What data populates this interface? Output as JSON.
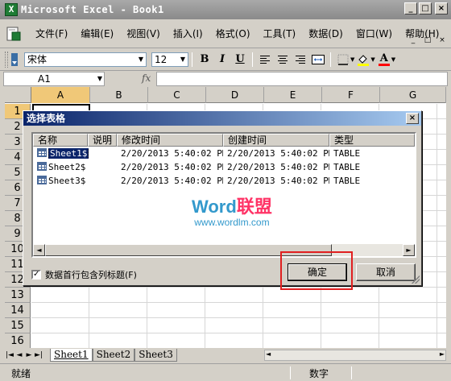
{
  "window": {
    "title": "Microsoft Excel - Book1",
    "app_icon": "X",
    "buttons": [
      "_",
      "□",
      "×"
    ]
  },
  "menu": {
    "items": [
      "文件(F)",
      "编辑(E)",
      "视图(V)",
      "插入(I)",
      "格式(O)",
      "工具(T)",
      "数据(D)",
      "窗口(W)",
      "帮助(H)"
    ],
    "right_buttons": [
      "_",
      "□",
      "×"
    ]
  },
  "toolbar": {
    "font_name": "宋体",
    "font_size": "12",
    "bold": "B",
    "italic": "I",
    "underline": "U",
    "font_color": "A"
  },
  "formula_bar": {
    "name_box": "A1",
    "fx_label": "fx",
    "formula": ""
  },
  "grid": {
    "columns": [
      "A",
      "B",
      "C",
      "D",
      "E",
      "F",
      "G"
    ],
    "rows": [
      "1",
      "2",
      "3",
      "4",
      "5",
      "6",
      "7",
      "8",
      "9",
      "10",
      "11",
      "12",
      "13",
      "14",
      "15",
      "16"
    ],
    "active_cell": "A1"
  },
  "sheet_tabs": {
    "nav": [
      "|◄",
      "◄",
      "►",
      "►|"
    ],
    "tabs": [
      "Sheet1",
      "Sheet2",
      "Sheet3"
    ],
    "active": "Sheet1"
  },
  "status_bar": {
    "left": "就绪",
    "right": "数字"
  },
  "dialog": {
    "title": "选择表格",
    "close": "×",
    "columns": [
      "名称",
      "说明",
      "修改时间",
      "创建时间",
      "类型"
    ],
    "rows": [
      {
        "name": "Sheet1$",
        "description": "",
        "modified": "2/20/2013 5:40:02 PM",
        "created": "2/20/2013 5:40:02 PM",
        "type": "TABLE"
      },
      {
        "name": "Sheet2$",
        "description": "",
        "modified": "2/20/2013 5:40:02 PM",
        "created": "2/20/2013 5:40:02 PM",
        "type": "TABLE"
      },
      {
        "name": "Sheet3$",
        "description": "",
        "modified": "2/20/2013 5:40:02 PM",
        "created": "2/20/2013 5:40:02 PM",
        "type": "TABLE"
      }
    ],
    "selected_row": 0,
    "checkbox_label": "数据首行包含列标题(F)",
    "checkbox_checked": "✓",
    "ok_label": "确定",
    "cancel_label": "取消",
    "scroll_left": "◄",
    "scroll_right": "►"
  },
  "watermark": {
    "brand_prefix": "Word",
    "brand_suffix": "联盟",
    "url": "www.wordlm.com"
  },
  "colors": {
    "dialog_title_start": "#0a246a",
    "dialog_title_end": "#a6caf0",
    "active_header": "#f0c878",
    "highlight_box": "#e02020",
    "watermark_pink": "#ff3366",
    "watermark_blue": "#3399cc"
  }
}
